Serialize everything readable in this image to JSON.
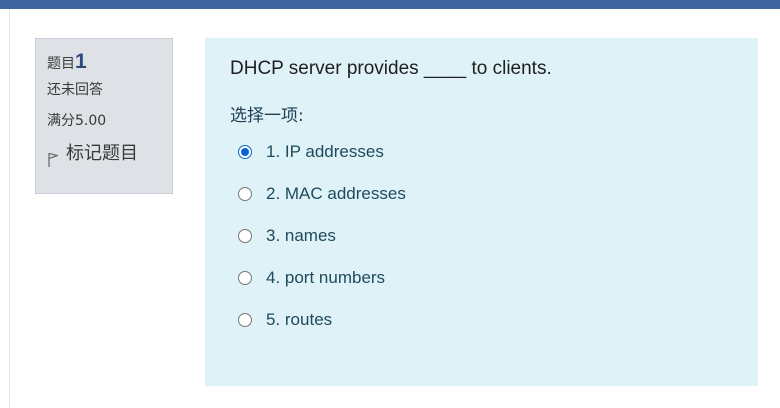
{
  "question_info": {
    "label": "题目",
    "number": "1",
    "state": "还未回答",
    "grade": "满分5.00",
    "flag_label": "标记题目"
  },
  "question": {
    "text": "DHCP server provides ____ to clients.",
    "prompt": "选择一项:",
    "answers": [
      {
        "label": "1. IP addresses",
        "checked": true
      },
      {
        "label": "2. MAC addresses",
        "checked": false
      },
      {
        "label": "3. names",
        "checked": false
      },
      {
        "label": "4. port numbers",
        "checked": false
      },
      {
        "label": "5. routes",
        "checked": false
      }
    ]
  },
  "colors": {
    "topbar": "#3e65a0",
    "info_bg": "#dee2e6",
    "content_bg": "#def2f8",
    "radio_checked": "#0a64d6"
  },
  "icons": {
    "flag": "flag-icon"
  }
}
